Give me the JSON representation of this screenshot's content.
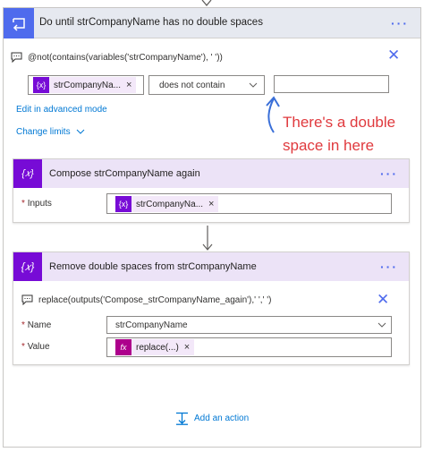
{
  "do_until": {
    "title": "Do until strCompanyName has no double spaces",
    "condition": {
      "expression": "@not(contains(variables('strCompanyName'), '  '))",
      "left_token": "strCompanyNa...",
      "operator": "does not contain",
      "right_value": "",
      "advanced_link": "Edit in advanced mode",
      "limits_link": "Change limits"
    }
  },
  "annotation": {
    "line1": "There's a double",
    "line2": "space in here"
  },
  "compose": {
    "title": "Compose strCompanyName again",
    "inputs_label": "Inputs",
    "inputs_token": "strCompanyNa..."
  },
  "set_variable": {
    "title": "Remove double spaces from strCompanyName",
    "expression": "replace(outputs('Compose_strCompanyName_again'),'  ',' ')",
    "name_label": "Name",
    "name_value": "strCompanyName",
    "value_label": "Value",
    "value_token": "replace(...)"
  },
  "footer": {
    "add_action": "Add an action"
  },
  "colors": {
    "loop_blue": "#4f6bed",
    "variable_purple": "#770bd6",
    "link_blue": "#0078d4",
    "annotation_red": "#e03a3e"
  },
  "icons": {
    "loop": "loop-icon",
    "variable": "curly-braces-icon",
    "expression": "fx-icon",
    "comment": "comment-icon",
    "close": "close-icon",
    "more": "more-options-icon",
    "add": "add-action-icon"
  }
}
